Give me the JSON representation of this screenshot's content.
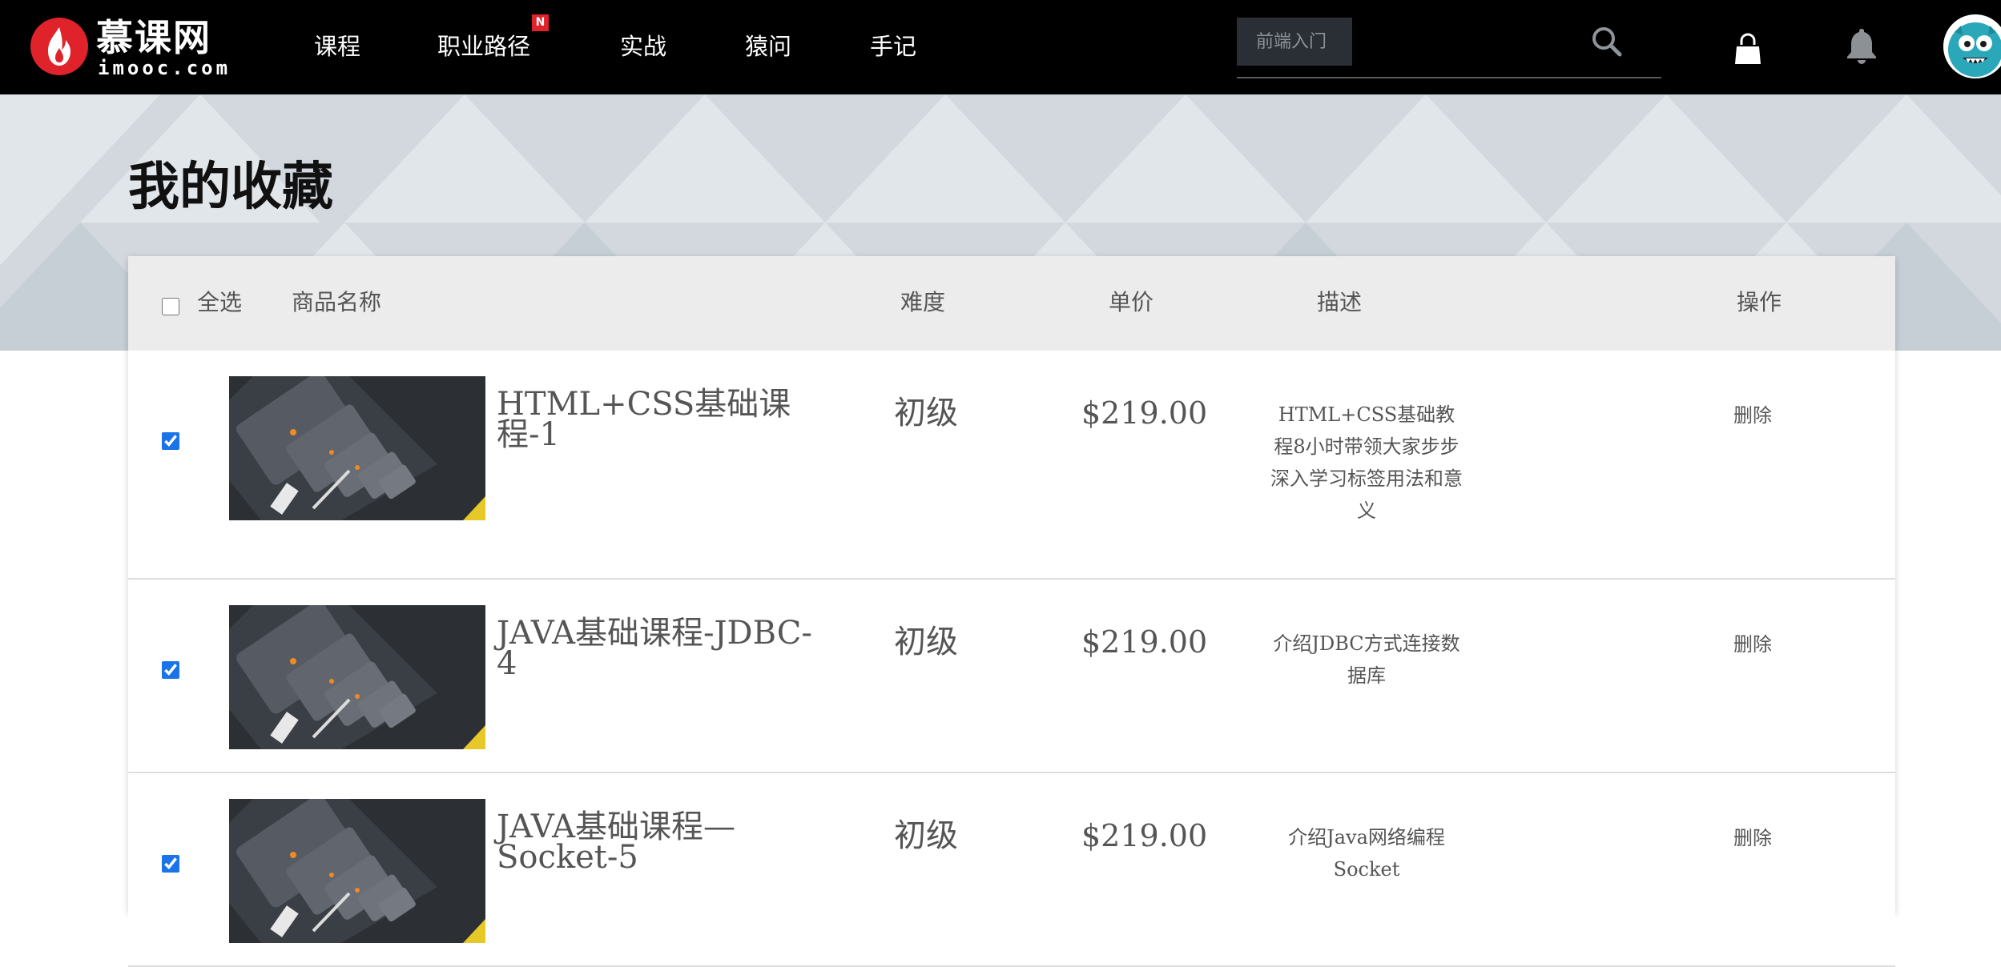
{
  "header": {
    "logo_text": "慕课网",
    "logo_sub": "imooc.com",
    "nav": [
      {
        "label": "课程"
      },
      {
        "label": "职业路径",
        "badge": "N"
      },
      {
        "label": "实战"
      },
      {
        "label": "猿问"
      },
      {
        "label": "手记"
      }
    ],
    "search": {
      "placeholder": "前端入门"
    },
    "icons": [
      "search-icon",
      "cart-icon",
      "bell-icon",
      "avatar"
    ],
    "colors": {
      "bar_bg": "#000000",
      "badge": "#e0222b",
      "logo_red": "#e0222b"
    }
  },
  "page": {
    "title": "我的收藏"
  },
  "table": {
    "headers": {
      "select_all": "全选",
      "name": "商品名称",
      "difficulty": "难度",
      "price": "单价",
      "description": "描述",
      "action": "操作"
    },
    "select_all_checked": false,
    "rows": [
      {
        "checked": true,
        "name": "HTML+CSS基础课程-1",
        "difficulty": "初级",
        "price": "$219.00",
        "description": "HTML+CSS基础教程8小时带领大家步步深入学习标签用法和意义",
        "action": "删除"
      },
      {
        "checked": true,
        "name": "JAVA基础课程-JDBC-4",
        "difficulty": "初级",
        "price": "$219.00",
        "description": "介绍JDBC方式连接数据库",
        "action": "删除"
      },
      {
        "checked": true,
        "name": "JAVA基础课程—Socket-5",
        "difficulty": "初级",
        "price": "$219.00",
        "description": "介绍Java网络编程Socket",
        "action": "删除"
      }
    ]
  }
}
